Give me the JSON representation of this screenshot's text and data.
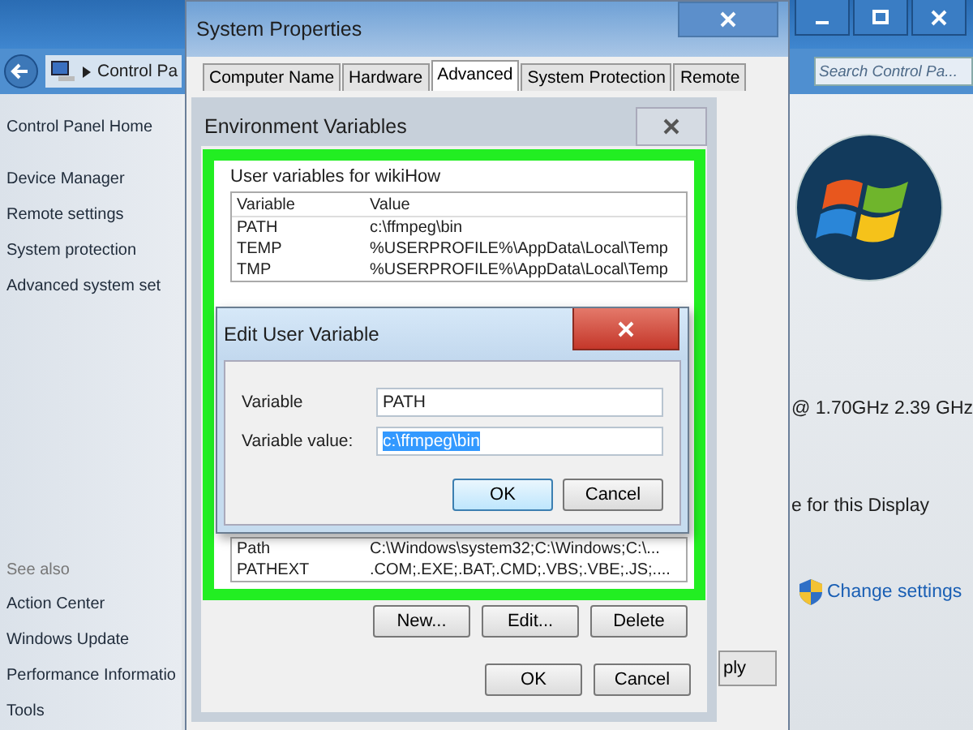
{
  "control_panel": {
    "address": "Control Pa",
    "search_placeholder": "Search Control Pa...",
    "sidebar_links": [
      "Control Panel Home",
      "Device Manager",
      "Remote settings",
      "System protection",
      "Advanced system set"
    ],
    "see_also_title": "See also",
    "see_also_links": [
      "Action Center",
      "Windows Update",
      "Performance Informatio",
      "Tools"
    ],
    "processor_speed": "@ 1.70GHz   2.39 GHz",
    "display_text": "e for this Display",
    "change_settings": "Change settings"
  },
  "system_properties": {
    "title": "System Properties",
    "tabs": [
      {
        "label": "Computer Name",
        "selected": false
      },
      {
        "label": "Hardware",
        "selected": false
      },
      {
        "label": "Advanced",
        "selected": true
      },
      {
        "label": "System Protection",
        "selected": false
      },
      {
        "label": "Remote",
        "selected": false
      }
    ],
    "apply_button": "ply"
  },
  "environment_variables": {
    "title": "Environment Variables",
    "user_vars_title": "User variables for wikiHow",
    "columns": [
      "Variable",
      "Value"
    ],
    "user_rows": [
      {
        "variable": "PATH",
        "value": " c:\\ffmpeg\\bin"
      },
      {
        "variable": "TEMP",
        "value": "%USERPROFILE%\\AppData\\Local\\Temp"
      },
      {
        "variable": "TMP",
        "value": "%USERPROFILE%\\AppData\\Local\\Temp"
      }
    ],
    "system_rows": [
      {
        "variable": "Path",
        "value": "C:\\Windows\\system32;C:\\Windows;C:\\..."
      },
      {
        "variable": "PATHEXT",
        "value": ".COM;.EXE;.BAT;.CMD;.VBS;.VBE;.JS;...."
      }
    ],
    "buttons": [
      "New...",
      "Edit...",
      "Delete"
    ],
    "dialog_buttons": [
      "OK",
      "Cancel"
    ]
  },
  "edit_dialog": {
    "title": "Edit User Variable",
    "fields": [
      {
        "label": "Variable",
        "value": "PATH",
        "text_selected": false
      },
      {
        "label": "Variable value:",
        "value": "c:\\ffmpeg\\bin",
        "text_selected": true
      }
    ],
    "buttons": [
      {
        "label": "OK",
        "focused": true
      },
      {
        "label": "Cancel",
        "focused": false
      }
    ]
  }
}
